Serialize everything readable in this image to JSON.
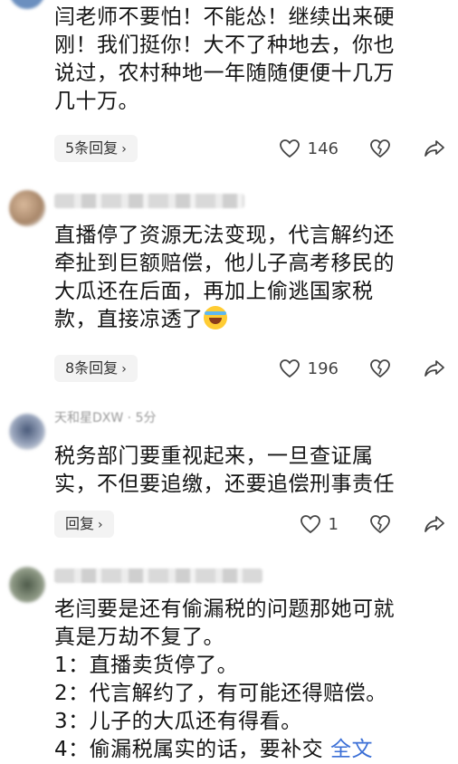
{
  "comments": [
    {
      "lines": [
        "闫老师不要怕！不能怂！继续出来硬",
        "刚！我们挺你！大不了种地去，你也",
        "说过，农村种地一年随随便便十几万",
        "几十万。"
      ],
      "reply_label": "5条回复",
      "likes": "146"
    },
    {
      "lines": [
        "直播停了资源无法变现，代言解约还",
        "牵扯到巨额赔偿，他儿子高考移民的",
        "大瓜还在后面，再加上偷逃国家税",
        "款，直接凉透了"
      ],
      "emoji": "laughing-crying-emoji",
      "reply_label": "8条回复",
      "likes": "196"
    },
    {
      "meta_partial": "天和星DXW · 5分",
      "lines": [
        "税务部门要重视起来，一旦查证属",
        "实，不但要追缴，还要追偿刑事责任"
      ],
      "reply_label": "回复",
      "likes": "1"
    },
    {
      "lines": [
        "老闫要是还有偷漏税的问题那她可就",
        "真是万劫不复了。",
        "1：直播卖货停了。",
        "2：代言解约了，有可能还得赔偿。",
        "3：儿子的大瓜还有得看。",
        "4：偷漏税属实的话，要补交"
      ],
      "full_text_label": "全文"
    }
  ],
  "reply_chevron": "›",
  "colors": {
    "link": "#3b6fd6",
    "reply_bg": "#f3f3f3"
  }
}
